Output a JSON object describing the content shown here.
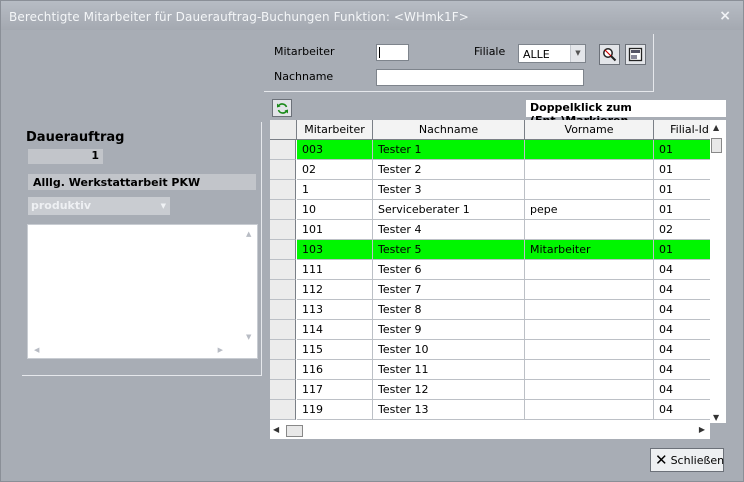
{
  "window": {
    "title": "Berechtigte Mitarbeiter für Dauerauftrag-Buchungen  Funktion: <WHmk1F>",
    "close_glyph": "×"
  },
  "filter": {
    "mitarbeiter_label": "Mitarbeiter",
    "mitarbeiter_value": "",
    "filiale_label": "Filiale",
    "filiale_value": "ALLE",
    "nachname_label": "Nachname",
    "nachname_value": "",
    "search_icon": "magnifier-icon",
    "clear_icon": "clear-filter-icon"
  },
  "dauerauftrag": {
    "title": "Dauerauftrag",
    "number": "1",
    "description": "Alllg. Werkstattarbeit PKW",
    "type_value": "produktiv",
    "memo": ""
  },
  "grid": {
    "hint": "Doppelklick zum (Ent-)Markieren",
    "refresh_icon": "refresh-icon",
    "columns": [
      "Mitarbeiter",
      "Nachname",
      "Vorname",
      "Filial-Id"
    ],
    "rows": [
      {
        "mitarbeiter": "003",
        "nachname": "Tester 1",
        "vorname": "",
        "filiale": "01",
        "selected": true
      },
      {
        "mitarbeiter": "02",
        "nachname": "Tester 2",
        "vorname": "",
        "filiale": "01",
        "selected": false
      },
      {
        "mitarbeiter": "1",
        "nachname": "Tester 3",
        "vorname": "",
        "filiale": "01",
        "selected": false
      },
      {
        "mitarbeiter": "10",
        "nachname": "Serviceberater 1",
        "vorname": "pepe",
        "filiale": "01",
        "selected": false
      },
      {
        "mitarbeiter": "101",
        "nachname": "Tester 4",
        "vorname": "",
        "filiale": "02",
        "selected": false
      },
      {
        "mitarbeiter": "103",
        "nachname": "Tester 5",
        "vorname": "Mitarbeiter",
        "filiale": "01",
        "selected": true
      },
      {
        "mitarbeiter": "111",
        "nachname": "Tester 6",
        "vorname": "",
        "filiale": "04",
        "selected": false
      },
      {
        "mitarbeiter": "112",
        "nachname": "Tester 7",
        "vorname": "",
        "filiale": "04",
        "selected": false
      },
      {
        "mitarbeiter": "113",
        "nachname": "Tester 8",
        "vorname": "",
        "filiale": "04",
        "selected": false
      },
      {
        "mitarbeiter": "114",
        "nachname": "Tester 9",
        "vorname": "",
        "filiale": "04",
        "selected": false
      },
      {
        "mitarbeiter": "115",
        "nachname": "Tester 10",
        "vorname": "",
        "filiale": "04",
        "selected": false
      },
      {
        "mitarbeiter": "116",
        "nachname": "Tester 11",
        "vorname": "",
        "filiale": "04",
        "selected": false
      },
      {
        "mitarbeiter": "117",
        "nachname": "Tester 12",
        "vorname": "",
        "filiale": "04",
        "selected": false
      },
      {
        "mitarbeiter": "119",
        "nachname": "Tester 13",
        "vorname": "",
        "filiale": "04",
        "selected": false
      }
    ],
    "selected_color": "#00f600"
  },
  "footer": {
    "close_label": "Schließen",
    "close_icon": "x-icon"
  }
}
